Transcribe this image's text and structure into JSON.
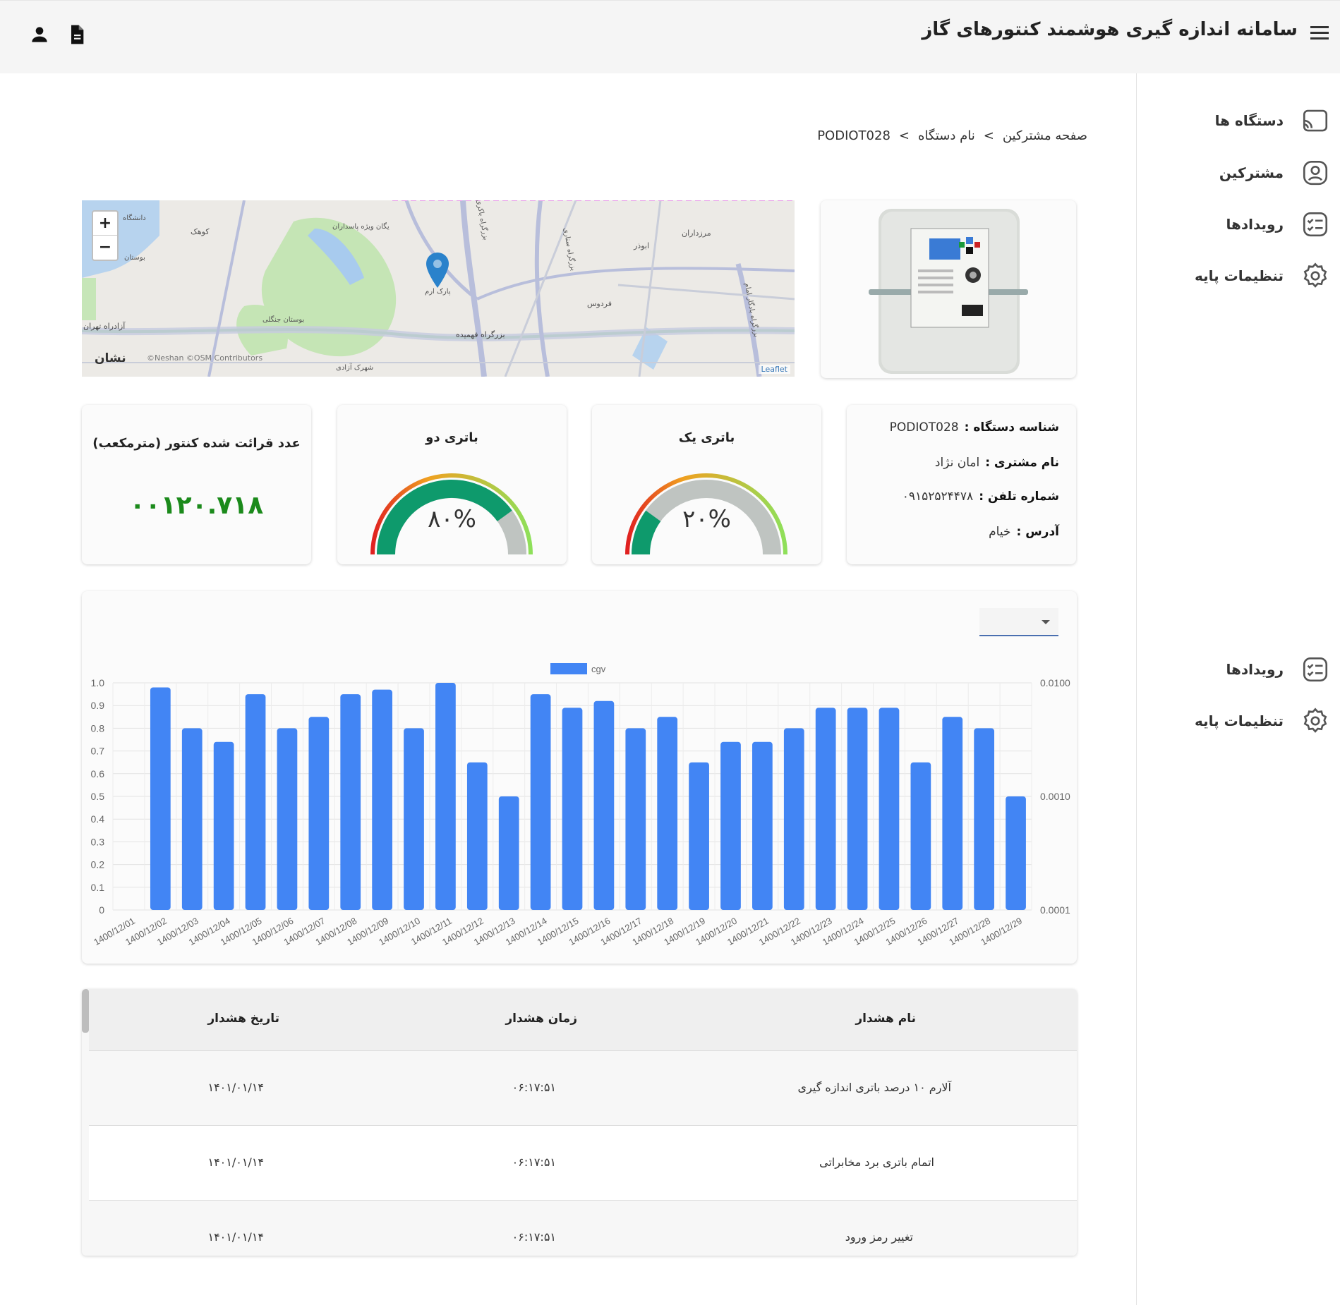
{
  "header": {
    "title": "سامانه اندازه گیری هوشمند کنتورهای گاز"
  },
  "sidebar": {
    "items": [
      {
        "label": "دستگاه ها"
      },
      {
        "label": "مشترکین"
      },
      {
        "label": "رویدادها"
      },
      {
        "label": "تنظیمات پایه"
      }
    ],
    "items2": [
      {
        "label": "رویدادها"
      },
      {
        "label": "تنظیمات پایه"
      }
    ]
  },
  "breadcrumb": {
    "home": "صفحه مشترکین",
    "sep": ">",
    "device_name": "نام دستگاه",
    "device_id": "PODIOT028"
  },
  "map": {
    "credit": "Leaflet",
    "logo": "نشان",
    "attribution": "©Neshan ©OSM Contributors",
    "labels": [
      "دانشگاه",
      "کوهک",
      "بوستان",
      "یگان ویژه پاسداران",
      "پارک ارم",
      "ابوذر",
      "مرزداران",
      "فردوس",
      "آزادراه تهران",
      "بزرگراه فهمیده",
      "بوستان جنگلی",
      "شهرک آزادی",
      "بزرگراه ستاری",
      "بزرگراه باکری",
      "بزرگراه یادگار امام"
    ]
  },
  "info": {
    "device_id_label": "شناسه دستگاه :",
    "device_id": "PODIOT028",
    "customer_label": "نام مشتری :",
    "customer": "امان نژاد",
    "phone_label": "شماره تلفن :",
    "phone": "۰۹۱۵۲۵۲۴۴۷۸",
    "address_label": "آدرس :",
    "address": "خیام"
  },
  "battery1": {
    "title": "باتری یک",
    "value": 20,
    "display": "۲۰%"
  },
  "battery2": {
    "title": "باتری دو",
    "value": 80,
    "display": "۸۰%"
  },
  "meter": {
    "title": "عدد قرائت شده کنتور (مترمکعب)",
    "reading": "۰۰۱۲۰.۷۱۸"
  },
  "colors": {
    "bar": "#4285f4",
    "gauge_fill": "#0e9a6c",
    "gauge_track": "#bfc4c1",
    "reading": "#1b8a1b"
  },
  "chart_data": {
    "type": "bar",
    "legend": "cgv",
    "categories": [
      "1400/12/01",
      "1400/12/02",
      "1400/12/03",
      "1400/12/04",
      "1400/12/05",
      "1400/12/06",
      "1400/12/07",
      "1400/12/08",
      "1400/12/09",
      "1400/12/10",
      "1400/12/11",
      "1400/12/12",
      "1400/12/13",
      "1400/12/14",
      "1400/12/15",
      "1400/12/16",
      "1400/12/17",
      "1400/12/18",
      "1400/12/19",
      "1400/12/20",
      "1400/12/21",
      "1400/12/22",
      "1400/12/23",
      "1400/12/24",
      "1400/12/25",
      "1400/12/26",
      "1400/12/27",
      "1400/12/28",
      "1400/12/29"
    ],
    "values": [
      0.98,
      0.8,
      0.74,
      0.95,
      0.8,
      0.85,
      0.95,
      0.97,
      0.8,
      1.0,
      0.65,
      0.5,
      0.95,
      0.89,
      0.92,
      0.8,
      0.85,
      0.65,
      0.74,
      0.74,
      0.8,
      0.89,
      0.89,
      0.89,
      0.65,
      0.85,
      0.8,
      0.5
    ],
    "ylim": [
      0,
      1
    ],
    "yticks": [
      "0",
      "0.1",
      "0.2",
      "0.3",
      "0.4",
      "0.5",
      "0.6",
      "0.7",
      "0.8",
      "0.9",
      "1.0"
    ],
    "y2ticks": [
      "0.0001",
      "0.0010",
      "0.0100"
    ],
    "grid": true,
    "legend_position": "top"
  },
  "table": {
    "headers": {
      "name": "نام هشدار",
      "time": "زمان هشدار",
      "date": "تاریخ هشدار"
    },
    "rows": [
      {
        "name": "آلارم ۱۰ درصد باتری اندازه گیری",
        "time": "۰۶:۱۷:۵۱",
        "date": "۱۴۰۱/۰۱/۱۴"
      },
      {
        "name": "اتمام باتری برد مخابراتی",
        "time": "۰۶:۱۷:۵۱",
        "date": "۱۴۰۱/۰۱/۱۴"
      },
      {
        "name": "تغییر رمز ورود",
        "time": "۰۶:۱۷:۵۱",
        "date": "۱۴۰۱/۰۱/۱۴"
      }
    ]
  }
}
